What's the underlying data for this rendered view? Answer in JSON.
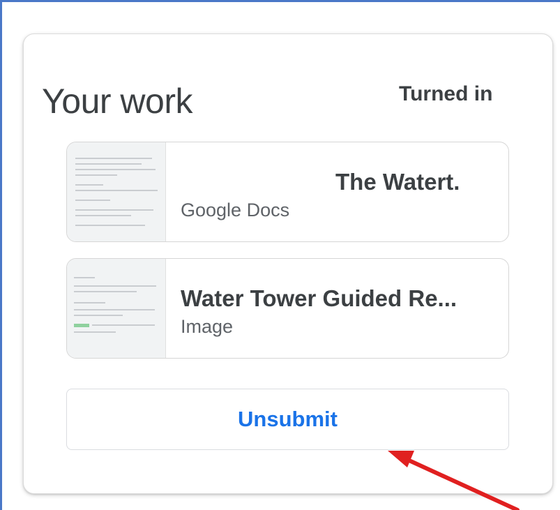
{
  "card": {
    "title": "Your work",
    "status": "Turned in"
  },
  "attachments": [
    {
      "name": "The Watert.",
      "type": "Google Docs"
    },
    {
      "name": "Water Tower Guided Re...",
      "type": "Image"
    }
  ],
  "actions": {
    "unsubmit_label": "Unsubmit"
  },
  "colors": {
    "accent": "#1a73e8",
    "annotation_arrow": "#e02020",
    "frame_border": "#4a78c8"
  },
  "icons": [
    "document-thumbnail",
    "image-thumbnail",
    "red-arrow-annotation"
  ]
}
